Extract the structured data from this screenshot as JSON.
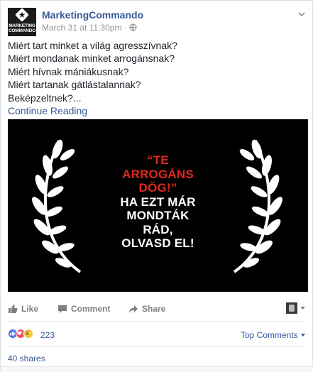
{
  "post": {
    "author": "MarketingCommando",
    "avatar_logo_text": "MARKETING COMMANDO",
    "timestamp": "March 31 at 11:30pm",
    "audience_icon": "globe-icon",
    "lines": [
      "Miért tart minket a világ agresszívnak?",
      "Miért mondanak minket arrogánsnak?",
      "Miért hívnak mániákusnak?",
      "Miért tartanak gátlástalannak?",
      "Beképzeltnek?..."
    ],
    "continue_label": "Continue Reading"
  },
  "media": {
    "headline_red": [
      "“TE",
      "ARROGÁNS",
      "DÖG!”"
    ],
    "headline_white": [
      "HA EZT MÁR",
      "MONDTÁK",
      "RÁD,",
      "OLVASD EL!"
    ],
    "colors": {
      "background": "#000000",
      "red": "#e0281e",
      "white": "#ffffff"
    }
  },
  "actions": {
    "like_label": "Like",
    "comment_label": "Comment",
    "share_label": "Share"
  },
  "reactions": {
    "icons": [
      "like-reaction-icon",
      "love-reaction-icon",
      "wow-reaction-icon"
    ],
    "count": "223",
    "top_comments_label": "Top Comments"
  },
  "shares": {
    "label": "40 shares"
  },
  "colors": {
    "link": "#365899",
    "meta": "#90949c"
  }
}
